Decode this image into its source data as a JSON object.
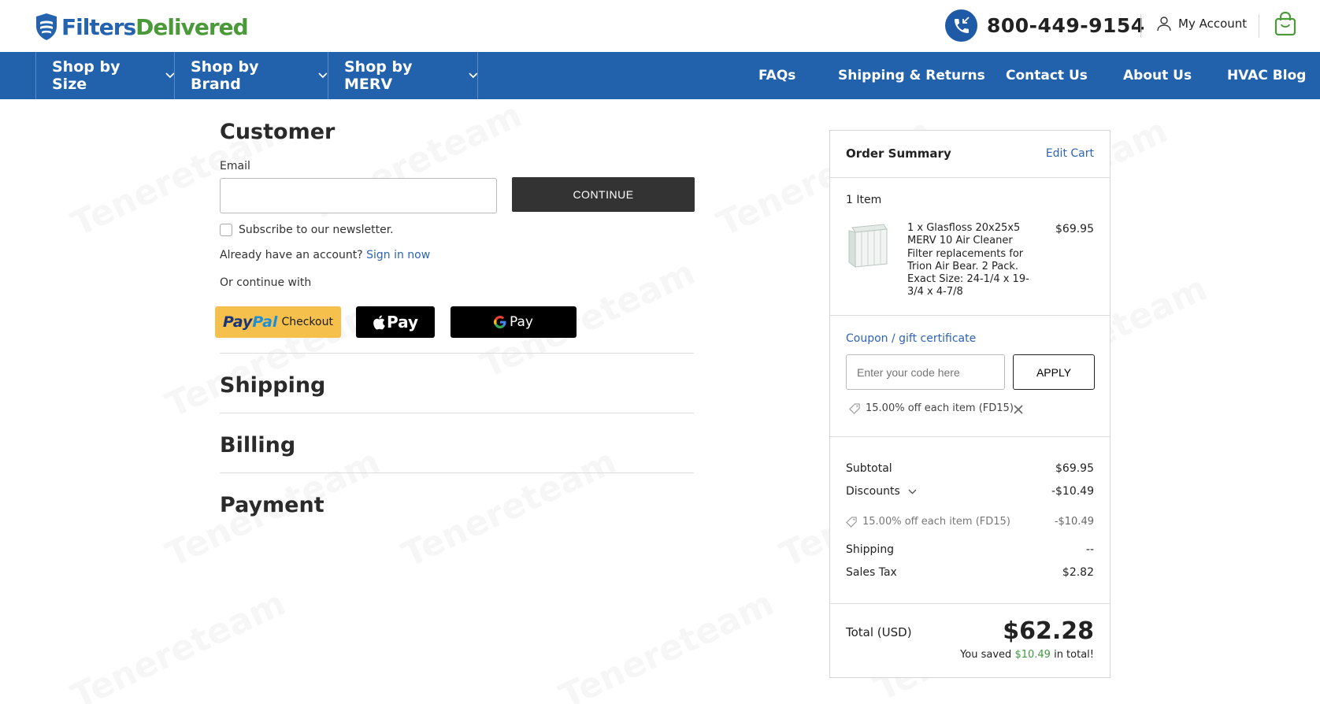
{
  "header": {
    "logo_part1": "Filters",
    "logo_part2": "Delivered",
    "phone": "800-449-9154",
    "account_label": "My Account"
  },
  "nav": {
    "dropdowns": [
      "Shop by Size",
      "Shop by Brand",
      "Shop by MERV"
    ],
    "links": [
      "FAQs",
      "Shipping & Returns",
      "Contact Us",
      "About Us",
      "HVAC Blog"
    ]
  },
  "checkout": {
    "customer_title": "Customer",
    "email_label": "Email",
    "email_value": "",
    "continue_label": "CONTINUE",
    "newsletter_label": "Subscribe to our newsletter.",
    "account_prompt": "Already have an account?",
    "signin_label": "Sign in now",
    "or_continue": "Or continue with",
    "paypal_pay": "Pay",
    "paypal_pal": "Pal",
    "paypal_checkout": "Checkout",
    "applepay_label": "Pay",
    "googlepay_label": "Pay",
    "shipping_title": "Shipping",
    "billing_title": "Billing",
    "payment_title": "Payment"
  },
  "summary": {
    "title": "Order Summary",
    "edit_cart": "Edit Cart",
    "item_count": "1 Item",
    "item_lines": [
      "1 x Glasfloss 20x25x5",
      "MERV 10 Air Cleaner",
      "Filter replacements for",
      "Trion Air Bear. 2 Pack.",
      "Exact Size: 24-1/4 x 19-",
      "3/4 x 4-7/8"
    ],
    "item_price": "$69.95",
    "coupon_link": "Coupon / gift certificate",
    "coupon_placeholder": "Enter your code here",
    "apply_label": "APPLY",
    "applied_coupon": "15.00% off each item (FD15)",
    "subtotal_label": "Subtotal",
    "subtotal_value": "$69.95",
    "discounts_label": "Discounts",
    "discounts_value": "-$10.49",
    "discount_detail_label": "15.00% off each item (FD15)",
    "discount_detail_value": "-$10.49",
    "shipping_label": "Shipping",
    "shipping_value": "--",
    "tax_label": "Sales Tax",
    "tax_value": "$2.82",
    "total_label": "Total (USD)",
    "total_value": "$62.28",
    "saved_prefix": "You saved",
    "saved_amount": "$10.49",
    "saved_suffix": "in total!"
  },
  "colors": {
    "nav_bg": "#2262ad",
    "link_blue": "#2d63b6",
    "saved_green": "#3f9a3f",
    "paypal_yellow": "#f5c04b"
  },
  "watermark": "Tenereteam"
}
